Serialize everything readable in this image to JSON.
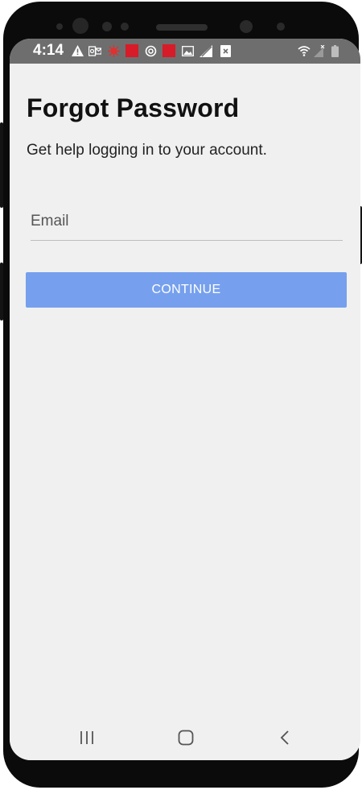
{
  "status_bar": {
    "time": "4:14",
    "icons": [
      "warning-icon",
      "outlook-icon",
      "virus-icon",
      "red-app-icon",
      "sync-icon",
      "red-app-icon",
      "image-icon",
      "no-signal-icon",
      "close-box-icon",
      "wifi-icon",
      "cellular-icon",
      "battery-icon"
    ]
  },
  "page": {
    "title": "Forgot Password",
    "subtitle": "Get help logging in to your account."
  },
  "form": {
    "email_placeholder": "Email",
    "email_value": "",
    "continue_label": "CONTINUE"
  },
  "nav": {
    "recents": "recents-icon",
    "home": "home-icon",
    "back": "back-icon"
  },
  "colors": {
    "button": "#76a0ee",
    "status_bar": "#6e6e6e",
    "screen_bg": "#f0f0f0"
  }
}
